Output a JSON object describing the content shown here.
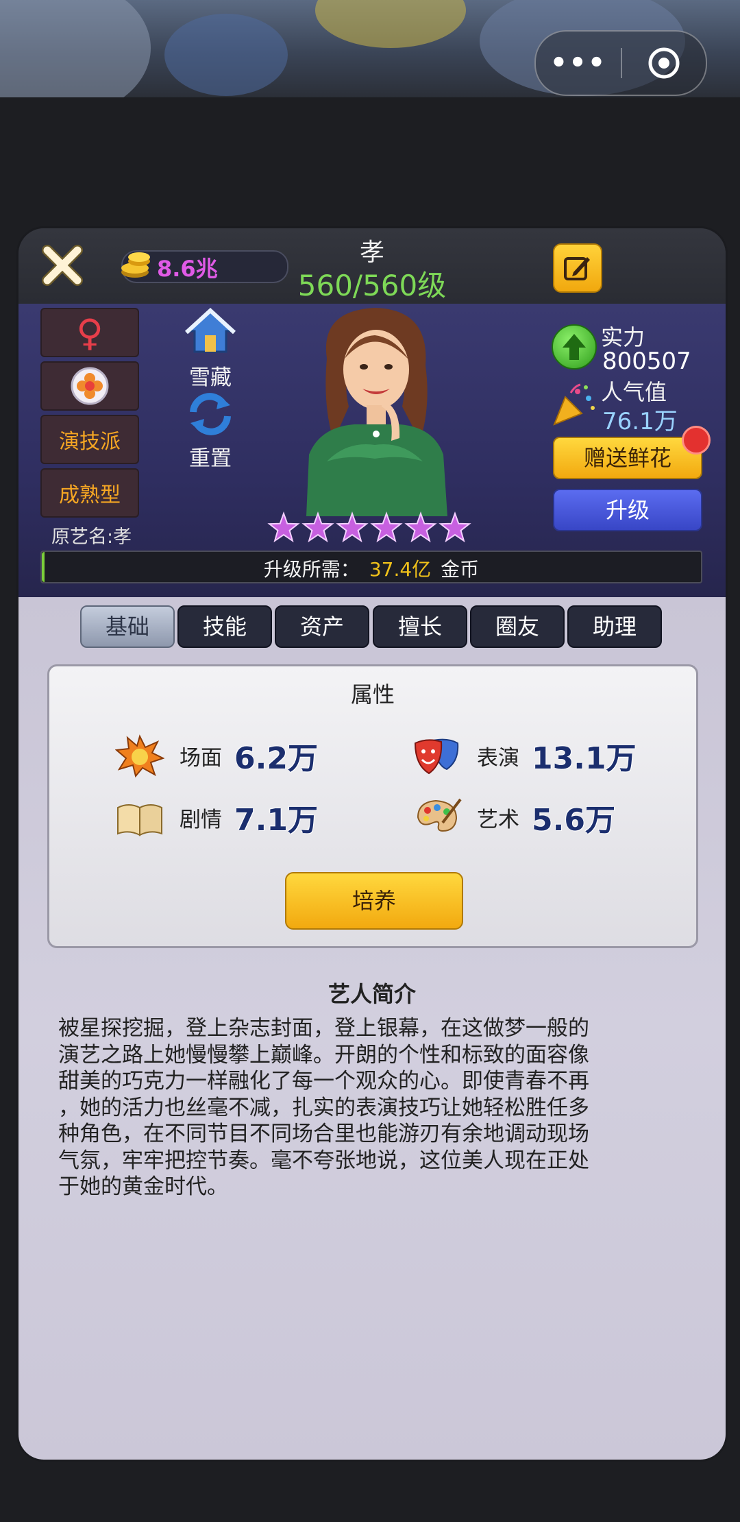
{
  "topbar": {
    "menu_dots": "•••",
    "icons": [
      "more-dots-icon",
      "target-icon"
    ]
  },
  "header": {
    "currency_value": "8.6兆",
    "character_name": "孝",
    "level": "560/560级"
  },
  "character": {
    "gender_symbol": "♀",
    "style_tags": [
      "演技派",
      "成熟型"
    ],
    "original_name": "原艺名:孝",
    "collect_label": "雪藏",
    "reset_label": "重置",
    "star_count": 6,
    "power_label": "实力",
    "power_value": "800507",
    "popularity_label": "人气值",
    "popularity_value": "76.1万",
    "gift_button": "赠送鲜花",
    "upgrade_button": "升级",
    "upgrade_req_label": "升级所需：",
    "upgrade_req_value": "37.4亿",
    "upgrade_req_unit": "金币",
    "progress_fraction": 0.004
  },
  "tabs": [
    "基础",
    "技能",
    "资产",
    "擅长",
    "圈友",
    "助理"
  ],
  "active_tab": 0,
  "attributes": {
    "title": "属性",
    "items": [
      {
        "label": "场面",
        "value": "6.2万",
        "icon": "explosion-icon"
      },
      {
        "label": "表演",
        "value": "13.1万",
        "icon": "drama-mask-icon"
      },
      {
        "label": "剧情",
        "value": "7.1万",
        "icon": "book-icon"
      },
      {
        "label": "艺术",
        "value": "5.6万",
        "icon": "palette-icon"
      }
    ],
    "train_button": "培养"
  },
  "intro": {
    "title": "艺人简介",
    "lines": [
      "被星探挖掘，登上杂志封面，登上银幕，在这做梦一般的",
      "演艺之路上她慢慢攀上巅峰。开朗的个性和标致的面容像",
      "甜美的巧克力一样融化了每一个观众的心。即使青春不再",
      "，她的活力也丝毫不减，扎实的表演技巧让她轻松胜任多",
      "种角色，在不同节目不同场合里也能游刃有余地调动现场",
      "气氛，牢牢把控节奏。毫不夸张地说，这位美人现在正处",
      "于她的黄金时代。"
    ]
  },
  "colors": {
    "level_green": "#7ed957",
    "gold_button": "#f2a90f",
    "upgrade_blue": "#3846c6",
    "currency_magenta": "#e05ae6",
    "req_number": "#f1c21a"
  }
}
